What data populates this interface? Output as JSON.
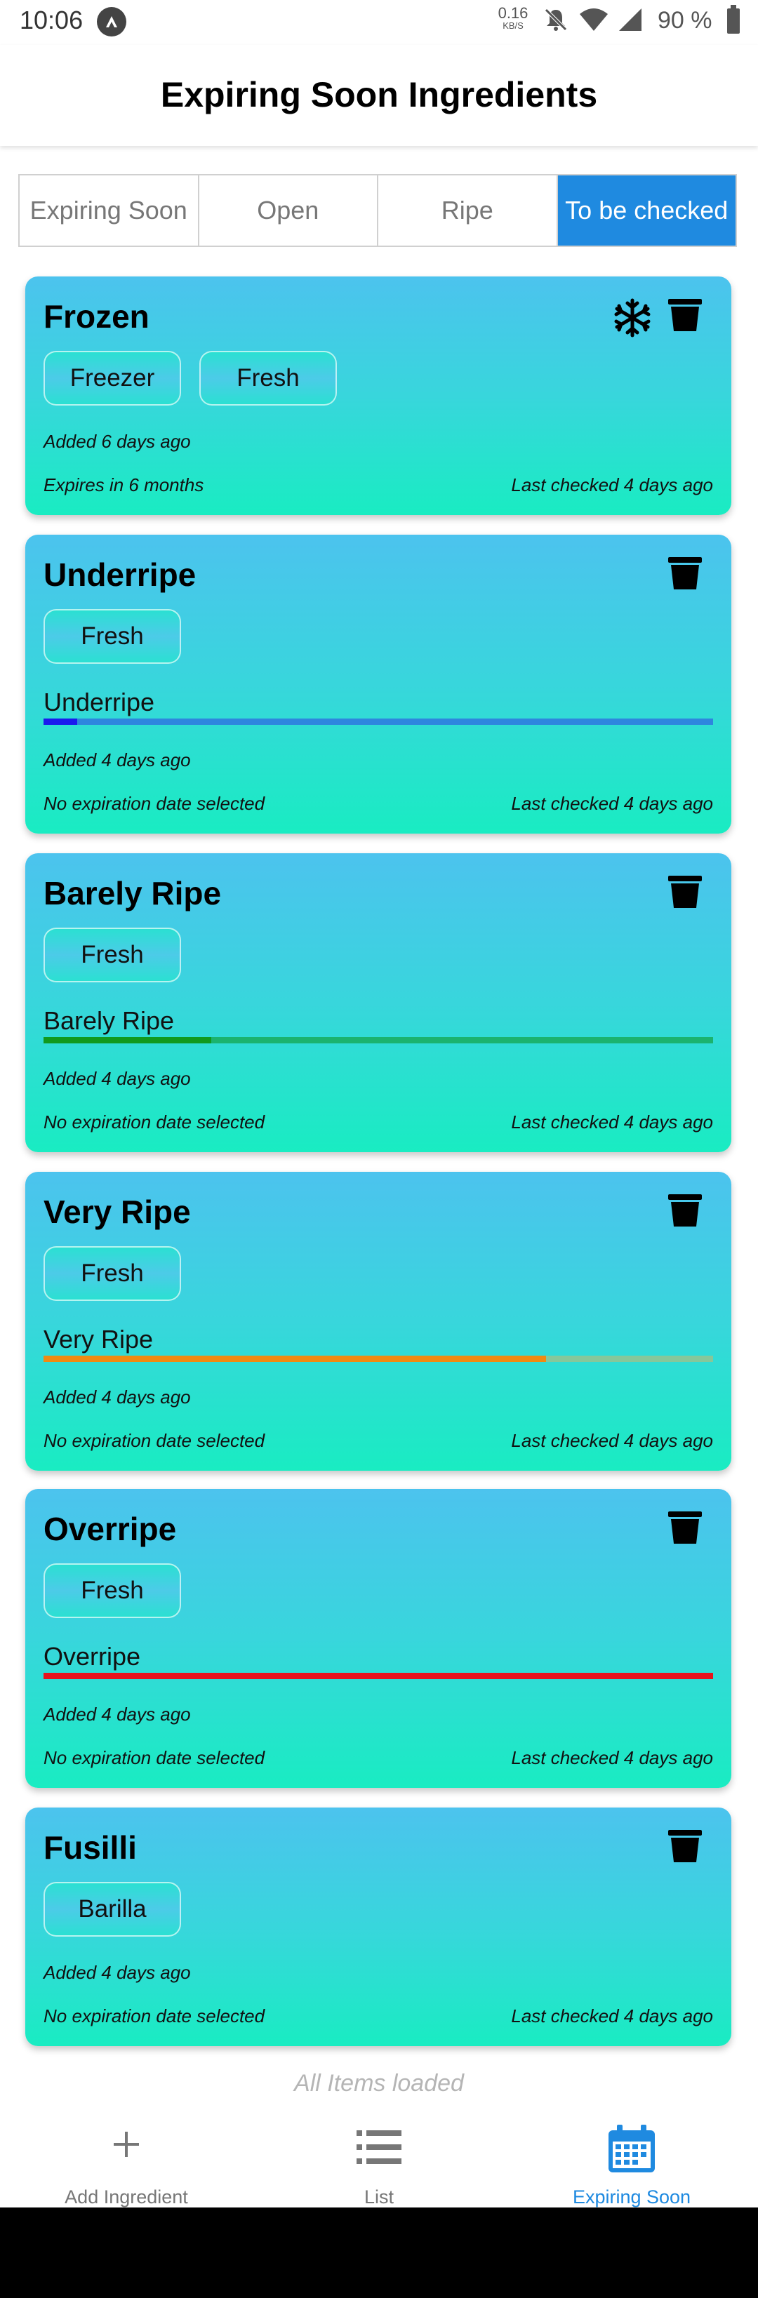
{
  "status_bar": {
    "time": "10:06",
    "speed_value": "0.16",
    "speed_unit": "KB/S",
    "battery": "90 %"
  },
  "header": {
    "title": "Expiring Soon Ingredients"
  },
  "tabs": [
    {
      "label": "Expiring Soon",
      "active": false
    },
    {
      "label": "Open",
      "active": false
    },
    {
      "label": "Ripe",
      "active": false
    },
    {
      "label": "To be checked",
      "active": true
    }
  ],
  "cards": [
    {
      "title": "Frozen",
      "chips": [
        "Freezer",
        "Fresh"
      ],
      "added": "Added 6 days ago",
      "expiry": "Expires in 6 months",
      "last_checked": "Last checked 4 days ago",
      "frozen_icon": "snowflake-icon"
    },
    {
      "title": "Underripe",
      "chips": [
        "Fresh"
      ],
      "ripeness_label": "Underripe",
      "ripeness_level": 0.05,
      "ripeness_color": "#1a1aee",
      "ripeness_track": "#2e86de",
      "added": "Added 4 days ago",
      "expiry": "No expiration date selected",
      "last_checked": "Last checked 4 days ago"
    },
    {
      "title": "Barely Ripe",
      "chips": [
        "Fresh"
      ],
      "ripeness_label": "Barely Ripe",
      "ripeness_level": 0.25,
      "ripeness_color": "#119a1e",
      "ripeness_track": "#1bb36e",
      "added": "Added 4 days ago",
      "expiry": "No expiration date selected",
      "last_checked": "Last checked 4 days ago"
    },
    {
      "title": "Very Ripe",
      "chips": [
        "Fresh"
      ],
      "ripeness_label": "Very Ripe",
      "ripeness_level": 0.75,
      "ripeness_color": "#f08a12",
      "ripeness_track": "#86c79a",
      "added": "Added 4 days ago",
      "expiry": "No expiration date selected",
      "last_checked": "Last checked 4 days ago"
    },
    {
      "title": "Overripe",
      "chips": [
        "Fresh"
      ],
      "ripeness_label": "Overripe",
      "ripeness_level": 1.0,
      "ripeness_color": "#e8141c",
      "ripeness_track": "#e8141c",
      "added": "Added 4 days ago",
      "expiry": "No expiration date selected",
      "last_checked": "Last checked 4 days ago"
    },
    {
      "title": "Fusilli",
      "chips": [
        "Barilla"
      ],
      "added": "Added 4 days ago",
      "expiry": "No expiration date selected",
      "last_checked": "Last checked 4 days ago"
    }
  ],
  "footer_text": "All Items loaded",
  "bottom_nav": [
    {
      "label": "Add Ingredient",
      "icon": "plus-icon",
      "active": false
    },
    {
      "label": "List",
      "icon": "list-icon",
      "active": false
    },
    {
      "label": "Expiring Soon",
      "icon": "calendar-icon",
      "active": true
    }
  ],
  "colors": {
    "accent": "#1f8ae0",
    "card_top": "#4cc3ee",
    "card_bottom": "#19ecc2"
  }
}
